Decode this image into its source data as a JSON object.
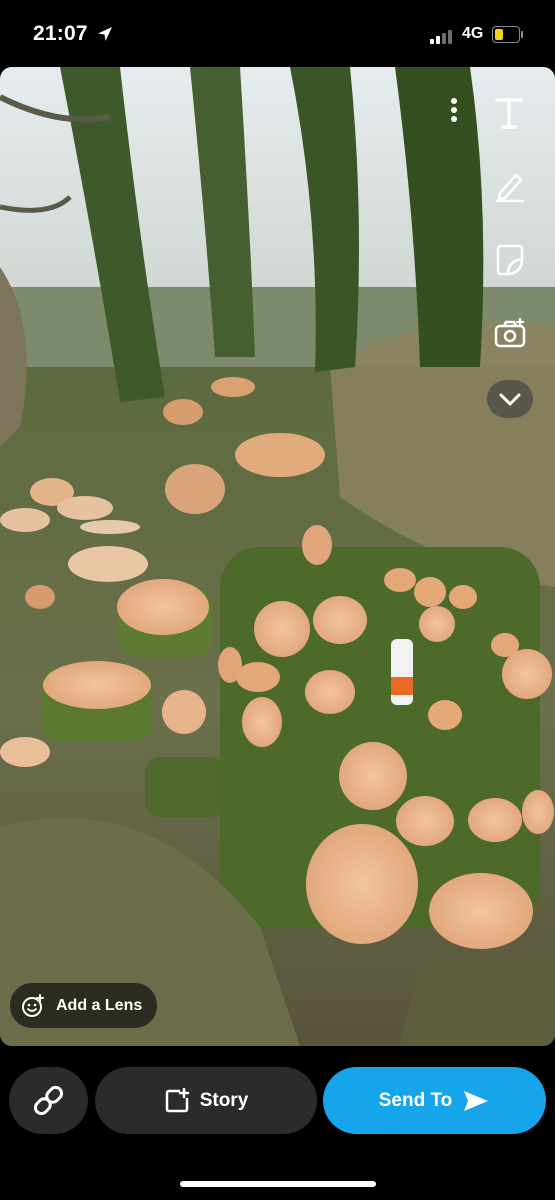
{
  "status_bar": {
    "time": "21:07",
    "network": "4G",
    "battery_level": 0.25,
    "battery_color": "#f4d21c",
    "icons": [
      "location-arrow-icon",
      "signal-icon",
      "battery-icon"
    ]
  },
  "photo": {
    "subject": "Stacked cut tree logs beneath ivy covered trees"
  },
  "tools": [
    "text-icon",
    "pencil-icon",
    "sticker-icon",
    "camera-swap-icon",
    "chevron-down-icon",
    "more-icon"
  ],
  "lens": {
    "label": "Add a Lens",
    "icon": "lens-smile-icon"
  },
  "bottom": {
    "link_icon": "link-icon",
    "story_label": "Story",
    "story_icon": "add-story-icon",
    "send_label": "Send To",
    "send_icon": "send-arrow-icon",
    "send_color": "#16a5ea"
  }
}
